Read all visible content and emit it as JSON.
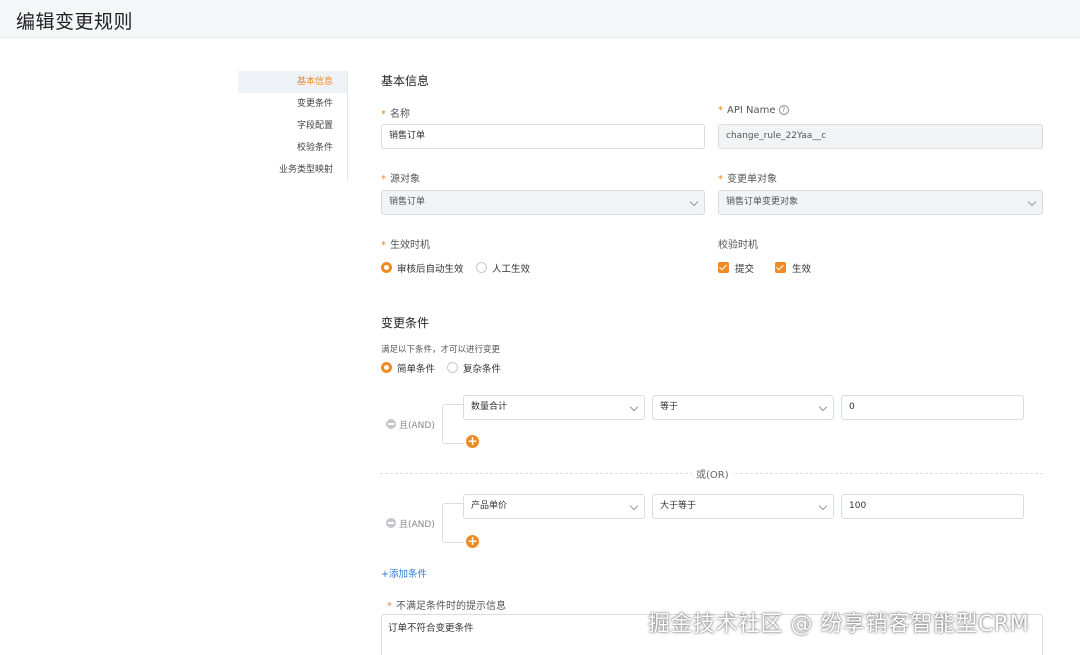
{
  "page": {
    "title": "编辑变更规则"
  },
  "nav": {
    "items": [
      {
        "label": "基本信息",
        "active": true
      },
      {
        "label": "变更条件",
        "active": false
      },
      {
        "label": "字段配置",
        "active": false
      },
      {
        "label": "校验条件",
        "active": false
      },
      {
        "label": "业务类型映射",
        "active": false
      }
    ]
  },
  "basic": {
    "section_title": "基本信息",
    "name": {
      "label": "名称",
      "value": "销售订单"
    },
    "api_name": {
      "label": "API Name",
      "value": "change_rule_22Yaa__c"
    },
    "source_object": {
      "label": "源对象",
      "value": "销售订单"
    },
    "change_object": {
      "label": "变更单对象",
      "value": "销售订单变更对象"
    },
    "effective": {
      "label": "生效时机",
      "options": [
        {
          "label": "审核后自动生效",
          "selected": true
        },
        {
          "label": "人工生效",
          "selected": false
        }
      ]
    },
    "validation": {
      "label": "校验时机",
      "options": [
        {
          "label": "提交",
          "checked": true
        },
        {
          "label": "生效",
          "checked": true
        }
      ]
    }
  },
  "conditions": {
    "section_title": "变更条件",
    "hint": "满足以下条件，才可以进行变更",
    "mode_options": [
      {
        "label": "简单条件",
        "selected": true
      },
      {
        "label": "复杂条件",
        "selected": false
      }
    ],
    "groups": [
      {
        "logic": "且(AND)",
        "field": "数量合计",
        "operator": "等于",
        "value": "0"
      },
      {
        "logic": "且(AND)",
        "field": "产品单价",
        "operator": "大于等于",
        "value": "100"
      }
    ],
    "or_label": "或(OR)",
    "add_condition": "+添加条件",
    "message_label": "不满足条件时的提示信息",
    "message_value": "订单不符合变更条件"
  },
  "watermark": "掘金技术社区 @ 纷享销客智能型CRM",
  "colors": {
    "accent": "#f08a24",
    "link": "#2e7bd6"
  }
}
